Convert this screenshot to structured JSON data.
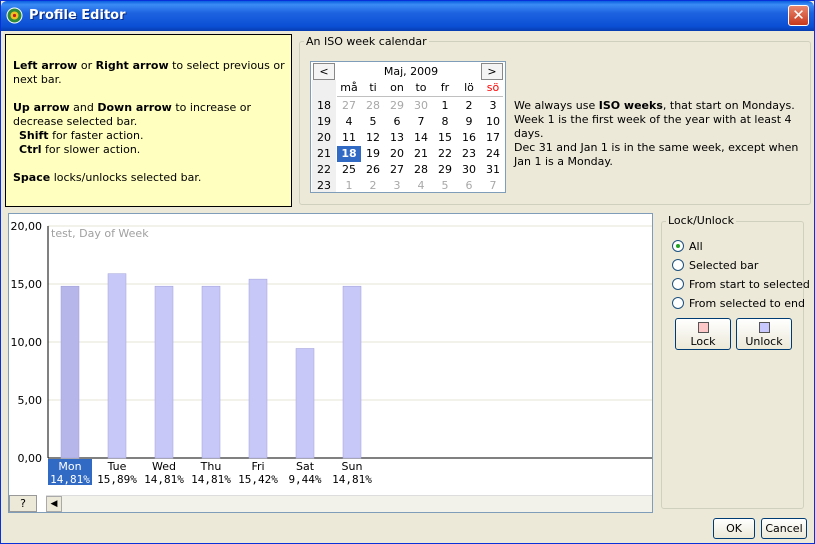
{
  "window": {
    "title": "Profile Editor",
    "close_label": "✕"
  },
  "help": {
    "p1_key1": "Left arrow",
    "p1_mid": " or ",
    "p1_key2": "Right arrow",
    "p1_rest": " to select previous or next bar.",
    "p2_key1": "Up arrow",
    "p2_mid": " and ",
    "p2_key2": "Down arrow",
    "p2_rest": " to increase or decrease selected bar.",
    "shift_key": "Shift",
    "shift_rest": " for faster action.",
    "ctrl_key": "Ctrl",
    "ctrl_rest": " for slower action.",
    "space_key": "Space",
    "space_rest": " locks/unlocks selected bar."
  },
  "calendar": {
    "legend": "An ISO week calendar",
    "prev": "<",
    "next": ">",
    "month": "Maj, 2009",
    "day_headers": [
      "må",
      "ti",
      "on",
      "to",
      "fr",
      "lö",
      "sö"
    ],
    "weeks": [
      {
        "wk": "18",
        "days": [
          "27",
          "28",
          "29",
          "30",
          "1",
          "2",
          "3"
        ],
        "dim": [
          true,
          true,
          true,
          true,
          false,
          false,
          false
        ]
      },
      {
        "wk": "19",
        "days": [
          "4",
          "5",
          "6",
          "7",
          "8",
          "9",
          "10"
        ],
        "dim": [
          false,
          false,
          false,
          false,
          false,
          false,
          false
        ]
      },
      {
        "wk": "20",
        "days": [
          "11",
          "12",
          "13",
          "14",
          "15",
          "16",
          "17"
        ],
        "dim": [
          false,
          false,
          false,
          false,
          false,
          false,
          false
        ]
      },
      {
        "wk": "21",
        "days": [
          "18",
          "19",
          "20",
          "21",
          "22",
          "23",
          "24"
        ],
        "dim": [
          false,
          false,
          false,
          false,
          false,
          false,
          false
        ]
      },
      {
        "wk": "22",
        "days": [
          "25",
          "26",
          "27",
          "28",
          "29",
          "30",
          "31"
        ],
        "dim": [
          false,
          false,
          false,
          false,
          false,
          false,
          false
        ]
      },
      {
        "wk": "23",
        "days": [
          "1",
          "2",
          "3",
          "4",
          "5",
          "6",
          "7"
        ],
        "dim": [
          true,
          true,
          true,
          true,
          true,
          true,
          true
        ]
      }
    ],
    "selected_day": "18"
  },
  "iso": {
    "pre": "We always use ",
    "strong": "ISO weeks",
    "post": ", that start on Mondays.",
    "line2": "Week 1 is the first week of the year with at least 4 days.",
    "line3": "Dec 31 and Jan 1 is in the same week, except when Jan 1 is a Monday."
  },
  "chart_data": {
    "type": "bar",
    "title": "test, Day of Week",
    "categories": [
      "Mon",
      "Tue",
      "Wed",
      "Thu",
      "Fri",
      "Sat",
      "Sun"
    ],
    "values": [
      14.81,
      15.89,
      14.81,
      14.81,
      15.42,
      9.44,
      14.81
    ],
    "percent_labels": [
      "14,81%",
      "15,89%",
      "14,81%",
      "14,81%",
      "15,42%",
      "9,44%",
      "14,81%"
    ],
    "ylim": [
      0,
      20
    ],
    "yticks": [
      0,
      5,
      10,
      15,
      20
    ],
    "ytick_labels": [
      "0,00",
      "5,00",
      "10,00",
      "15,00",
      "20,00"
    ],
    "selected_index": 0,
    "colors": {
      "bar": "#c8c8f8",
      "bar_selected": "#b6b6ea",
      "bar_stroke": "#9e9ed8",
      "selected_label_bg": "#316ac5",
      "grid": "#e6e6d6"
    }
  },
  "bottom": {
    "help_label": "?",
    "scroll_left": "◀"
  },
  "lock": {
    "legend": "Lock/Unlock",
    "options": [
      "All",
      "Selected bar",
      "From start to selected",
      "From selected to end"
    ],
    "selected": 0,
    "lock_label": "Lock",
    "unlock_label": "Unlock",
    "lock_color": "#ffc8c8",
    "unlock_color": "#c8c8ff"
  },
  "buttons": {
    "ok": "OK",
    "cancel": "Cancel"
  }
}
